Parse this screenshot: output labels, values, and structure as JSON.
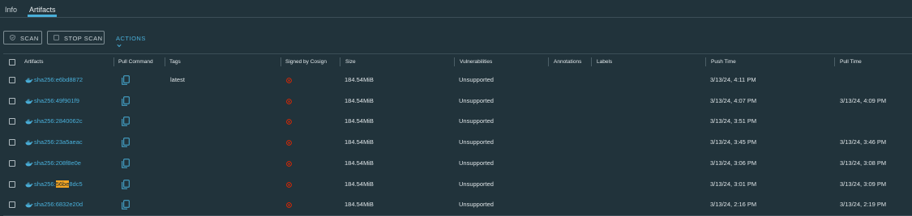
{
  "tabs": [
    {
      "label": "Info",
      "active": false
    },
    {
      "label": "Artifacts",
      "active": true
    }
  ],
  "toolbar": {
    "scan_label": "SCAN",
    "stop_scan_label": "STOP SCAN",
    "actions_label": "ACTIONS"
  },
  "columns": [
    "Artifacts",
    "Pull Command",
    "Tags",
    "Signed by Cosign",
    "Size",
    "Vulnerabilities",
    "Annotations",
    "Labels",
    "Push Time",
    "Pull Time"
  ],
  "colors": {
    "accent": "#49afd9",
    "background": "#21333b",
    "error": "#e62700",
    "highlight": "#f5a623"
  },
  "rows": [
    {
      "digest": "sha256:e6bd8872",
      "tags": "latest",
      "signed": "error-circle-icon",
      "size": "184.54MiB",
      "vulnerabilities": "Unsupported",
      "annotations": "",
      "labels": "",
      "push_time": "3/13/24, 4:11 PM",
      "pull_time": ""
    },
    {
      "digest": "sha256:49f901f9",
      "tags": "",
      "signed": "error-circle-icon",
      "size": "184.54MiB",
      "vulnerabilities": "Unsupported",
      "annotations": "",
      "labels": "",
      "push_time": "3/13/24, 4:07 PM",
      "pull_time": "3/13/24, 4:09 PM"
    },
    {
      "digest": "sha256:2840062c",
      "tags": "",
      "signed": "error-circle-icon",
      "size": "184.54MiB",
      "vulnerabilities": "Unsupported",
      "annotations": "",
      "labels": "",
      "push_time": "3/13/24, 3:51 PM",
      "pull_time": ""
    },
    {
      "digest": "sha256:23a5aeac",
      "tags": "",
      "signed": "error-circle-icon",
      "size": "184.54MiB",
      "vulnerabilities": "Unsupported",
      "annotations": "",
      "labels": "",
      "push_time": "3/13/24, 3:45 PM",
      "pull_time": "3/13/24, 3:46 PM"
    },
    {
      "digest": "sha256:208f8e0e",
      "tags": "",
      "signed": "error-circle-icon",
      "size": "184.54MiB",
      "vulnerabilities": "Unsupported",
      "annotations": "",
      "labels": "",
      "push_time": "3/13/24, 3:06 PM",
      "pull_time": "3/13/24, 3:08 PM"
    },
    {
      "digest_prefix": "sha256:",
      "digest_highlight": "56be",
      "digest_suffix": "8dc5",
      "tags": "",
      "signed": "error-circle-icon",
      "size": "184.54MiB",
      "vulnerabilities": "Unsupported",
      "annotations": "",
      "labels": "",
      "push_time": "3/13/24, 3:01 PM",
      "pull_time": "3/13/24, 3:09 PM"
    },
    {
      "digest": "sha256:6832e20d",
      "tags": "",
      "signed": "error-circle-icon",
      "size": "184.54MiB",
      "vulnerabilities": "Unsupported",
      "annotations": "",
      "labels": "",
      "push_time": "3/13/24, 2:16 PM",
      "pull_time": "3/13/24, 2:19 PM"
    }
  ]
}
